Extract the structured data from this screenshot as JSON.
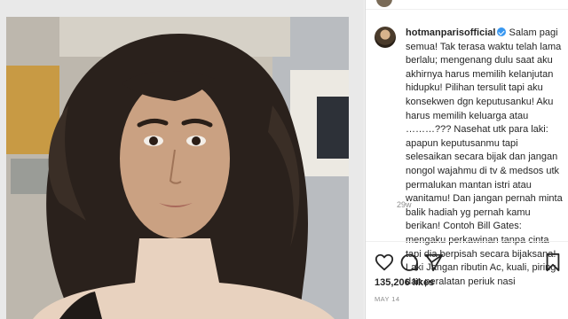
{
  "post": {
    "username": "hotmanparisofficial",
    "caption": "Salam pagi semua! Tak terasa waktu telah lama berlalu; mengenang dulu saat aku akhirnya harus memilih kelanjutan hidupku! Pilihan tersulit tapi aku konsekwen dgn keputusanku! Aku harus memilih keluarga atau ………??? Nasehat utk para laki: apapun keputusanmu tapi selesaikan secara bijak dan jangan nongol wajahmu di tv & medsos utk permalukan mantan istri atau wanitamu! Dan jangan pernah minta balik hadiah yg pernah kamu berikan! Contoh Bill Gates: mengaku perkawinan tanpa cinta tapi dia berpisah secara bijaksana! Laki Jangan ributin Ac, kuali, piring dan peralatan periuk nasi",
    "age": "29w",
    "likes": "135,206 likes",
    "date": "MAY 14"
  },
  "icons": {
    "like": "heart-icon",
    "comment": "comment-bubble-icon",
    "share": "paper-plane-icon",
    "save": "bookmark-icon",
    "verified": "verified-badge-icon"
  },
  "colors": {
    "verified": "#3897f0",
    "text": "#262626",
    "muted": "#8e8e8e",
    "border": "#dbdbdb"
  }
}
